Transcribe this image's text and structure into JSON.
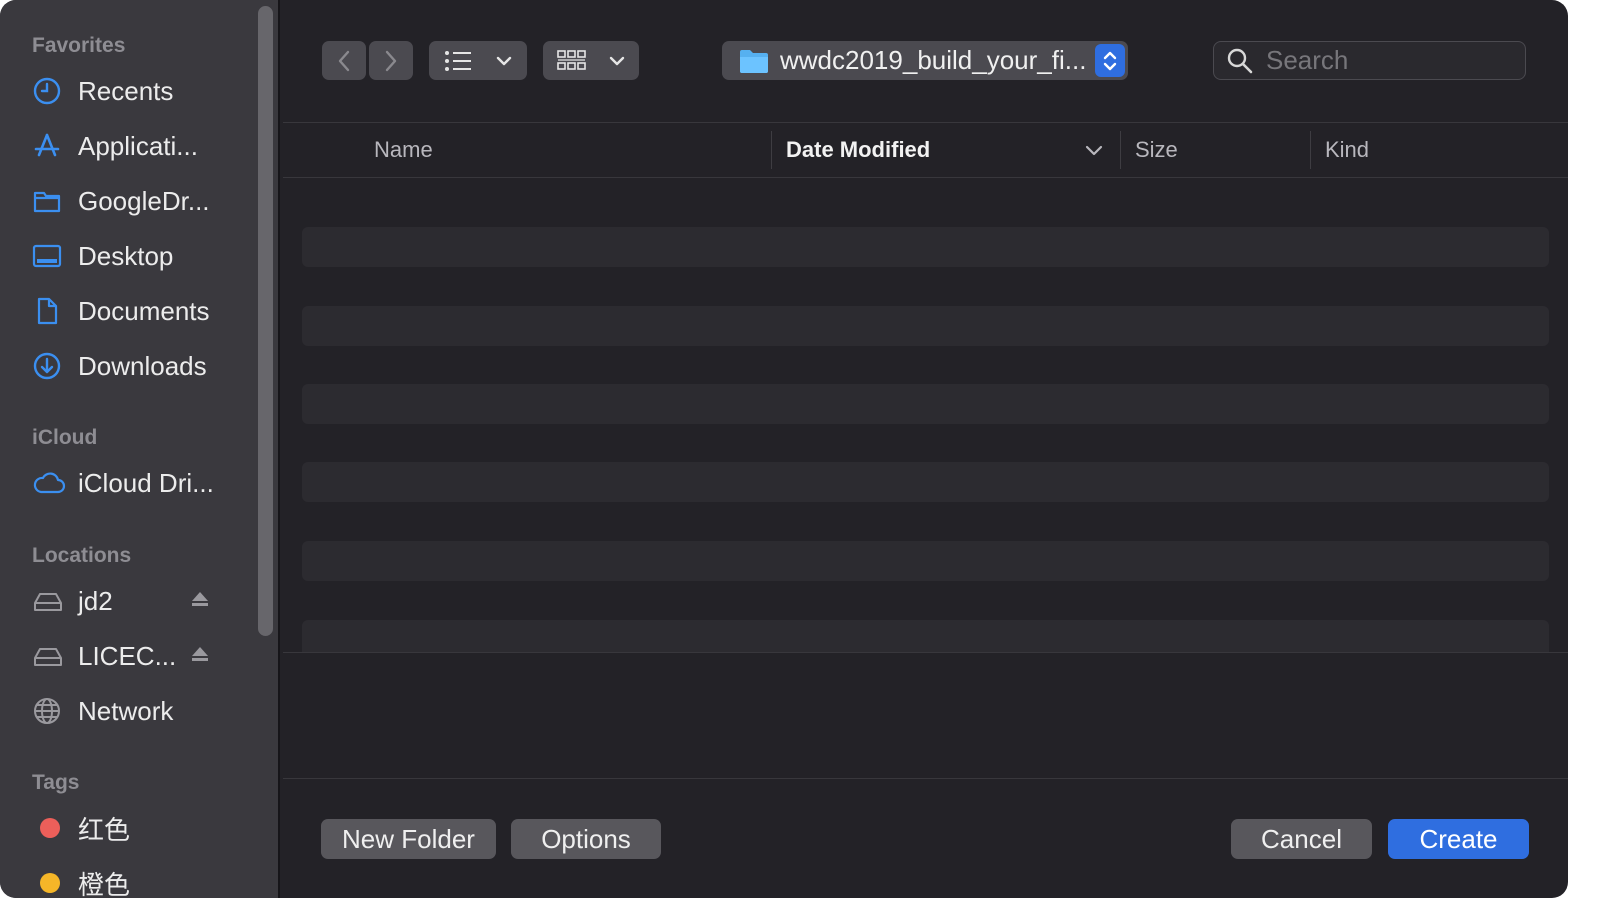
{
  "sidebar": {
    "sections": {
      "favorites": "Favorites",
      "icloud": "iCloud",
      "locations": "Locations",
      "tags": "Tags"
    },
    "favorites": [
      {
        "label": "Recents",
        "icon": "clock-icon"
      },
      {
        "label": "Applicati...",
        "icon": "app-store-icon"
      },
      {
        "label": "GoogleDr...",
        "icon": "folder-icon"
      },
      {
        "label": "Desktop",
        "icon": "desktop-icon"
      },
      {
        "label": "Documents",
        "icon": "document-icon"
      },
      {
        "label": "Downloads",
        "icon": "download-icon"
      }
    ],
    "icloud": [
      {
        "label": "iCloud Dri...",
        "icon": "cloud-icon"
      }
    ],
    "locations": [
      {
        "label": "jd2",
        "icon": "drive-icon",
        "eject": true
      },
      {
        "label": "LICEC...",
        "icon": "drive-icon",
        "eject": true
      },
      {
        "label": "Network",
        "icon": "globe-icon"
      }
    ],
    "tags": [
      {
        "label": "红色",
        "color": "#ec5f5a"
      },
      {
        "label": "橙色",
        "color": "#f5b628"
      }
    ]
  },
  "toolbar": {
    "path": "wwdc2019_build_your_fi...",
    "search_placeholder": "Search"
  },
  "columns": [
    {
      "label": "Name",
      "sorted": false
    },
    {
      "label": "Date Modified",
      "sorted": true
    },
    {
      "label": "Size",
      "sorted": false
    },
    {
      "label": "Kind",
      "sorted": false
    }
  ],
  "footer": {
    "new_folder": "New Folder",
    "options": "Options",
    "cancel": "Cancel",
    "create": "Create"
  },
  "colors": {
    "accent": "#2f6ee0",
    "sidebar_icon": "#3b8ff0"
  }
}
